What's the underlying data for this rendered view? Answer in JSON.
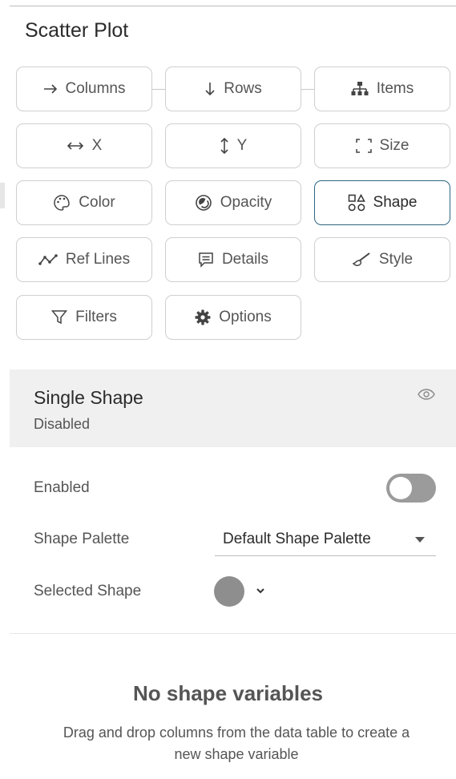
{
  "panel": {
    "title": "Scatter Plot"
  },
  "tiles": [
    {
      "label": "Columns",
      "icon": "arrow-right-icon"
    },
    {
      "label": "Rows",
      "icon": "arrow-down-icon"
    },
    {
      "label": "Items",
      "icon": "hierarchy-icon"
    },
    {
      "label": "X",
      "icon": "horizontal-arrows-icon"
    },
    {
      "label": "Y",
      "icon": "vertical-arrows-icon"
    },
    {
      "label": "Size",
      "icon": "size-brackets-icon"
    },
    {
      "label": "Color",
      "icon": "palette-icon"
    },
    {
      "label": "Opacity",
      "icon": "opacity-icon"
    },
    {
      "label": "Shape",
      "icon": "shapes-icon",
      "active": true
    },
    {
      "label": "Ref Lines",
      "icon": "ref-lines-icon"
    },
    {
      "label": "Details",
      "icon": "details-icon"
    },
    {
      "label": "Style",
      "icon": "brush-icon"
    },
    {
      "label": "Filters",
      "icon": "filter-icon"
    },
    {
      "label": "Options",
      "icon": "gear-icon"
    }
  ],
  "section": {
    "title": "Single Shape",
    "status": "Disabled",
    "icon": "eye-icon"
  },
  "settings": {
    "enabled_label": "Enabled",
    "enabled": false,
    "palette_label": "Shape Palette",
    "palette_value": "Default Shape Palette",
    "selected_shape_label": "Selected Shape",
    "selected_shape": "circle",
    "selected_shape_color": "#8e8e8e"
  },
  "empty_state": {
    "title": "No shape variables",
    "description": "Drag and drop columns from the data table to create a new shape variable"
  },
  "colors": {
    "active_border": "#2d6680",
    "toggle_off": "#9b9b9b"
  }
}
